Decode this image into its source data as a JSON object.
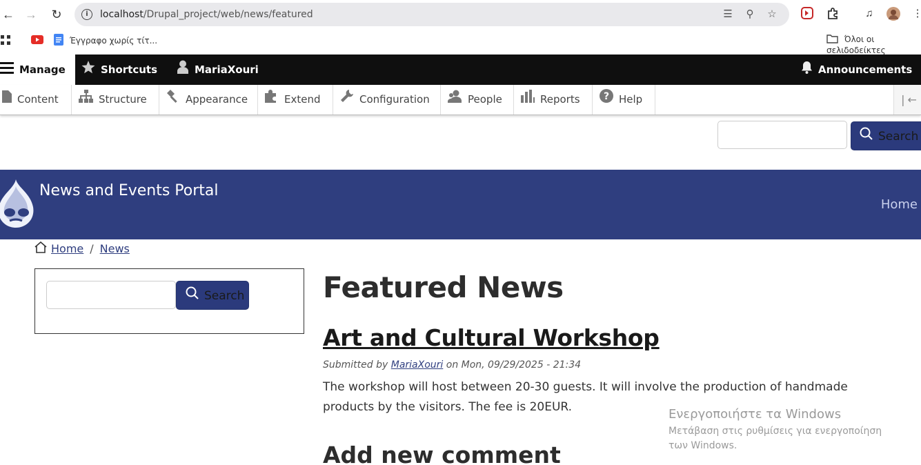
{
  "browser": {
    "url_host": "localhost",
    "url_path": "/Drupal_project/web/news/featured",
    "bookmarks": [
      {
        "label": "Έγγραφο χωρίς τίτ..."
      },
      {
        "label": "Όλοι οι σελιδοδείκτες"
      }
    ]
  },
  "toolbar": {
    "manage": "Manage",
    "shortcuts": "Shortcuts",
    "user": "MariaXouri",
    "announcements": "Announcements",
    "tray": [
      {
        "label": "Content"
      },
      {
        "label": "Structure"
      },
      {
        "label": "Appearance"
      },
      {
        "label": "Extend"
      },
      {
        "label": "Configuration"
      },
      {
        "label": "People"
      },
      {
        "label": "Reports"
      },
      {
        "label": "Help"
      }
    ]
  },
  "top_search": {
    "button": "Search",
    "value": ""
  },
  "header": {
    "site_name": "News and Events Portal",
    "home": "Home"
  },
  "breadcrumb": {
    "home": "Home",
    "separator": "/",
    "news": "News"
  },
  "sidebar_search": {
    "button": "Search",
    "value": ""
  },
  "main": {
    "title": "Featured News",
    "article": {
      "title": "Art and Cultural Workshop",
      "submitted_prefix": "Submitted by",
      "author": "MariaXouri",
      "submitted_on": "on Mon, 09/29/2025 - 21:34",
      "body": "The workshop will host between 20-30 guests. It will involve the production of handmade products by the visitors. The fee is 20EUR."
    },
    "comment_heading": "Add new comment"
  },
  "watermark": {
    "title": "Ενεργοποιήστε τα Windows",
    "subtitle": "Μετάβαση στις ρυθμίσεις για ενεργοποίηση των Windows."
  },
  "colors": {
    "brand": "#2f3e7f",
    "toolbar_bg": "#0f0f0f",
    "search_button": "#2b3a7c"
  }
}
